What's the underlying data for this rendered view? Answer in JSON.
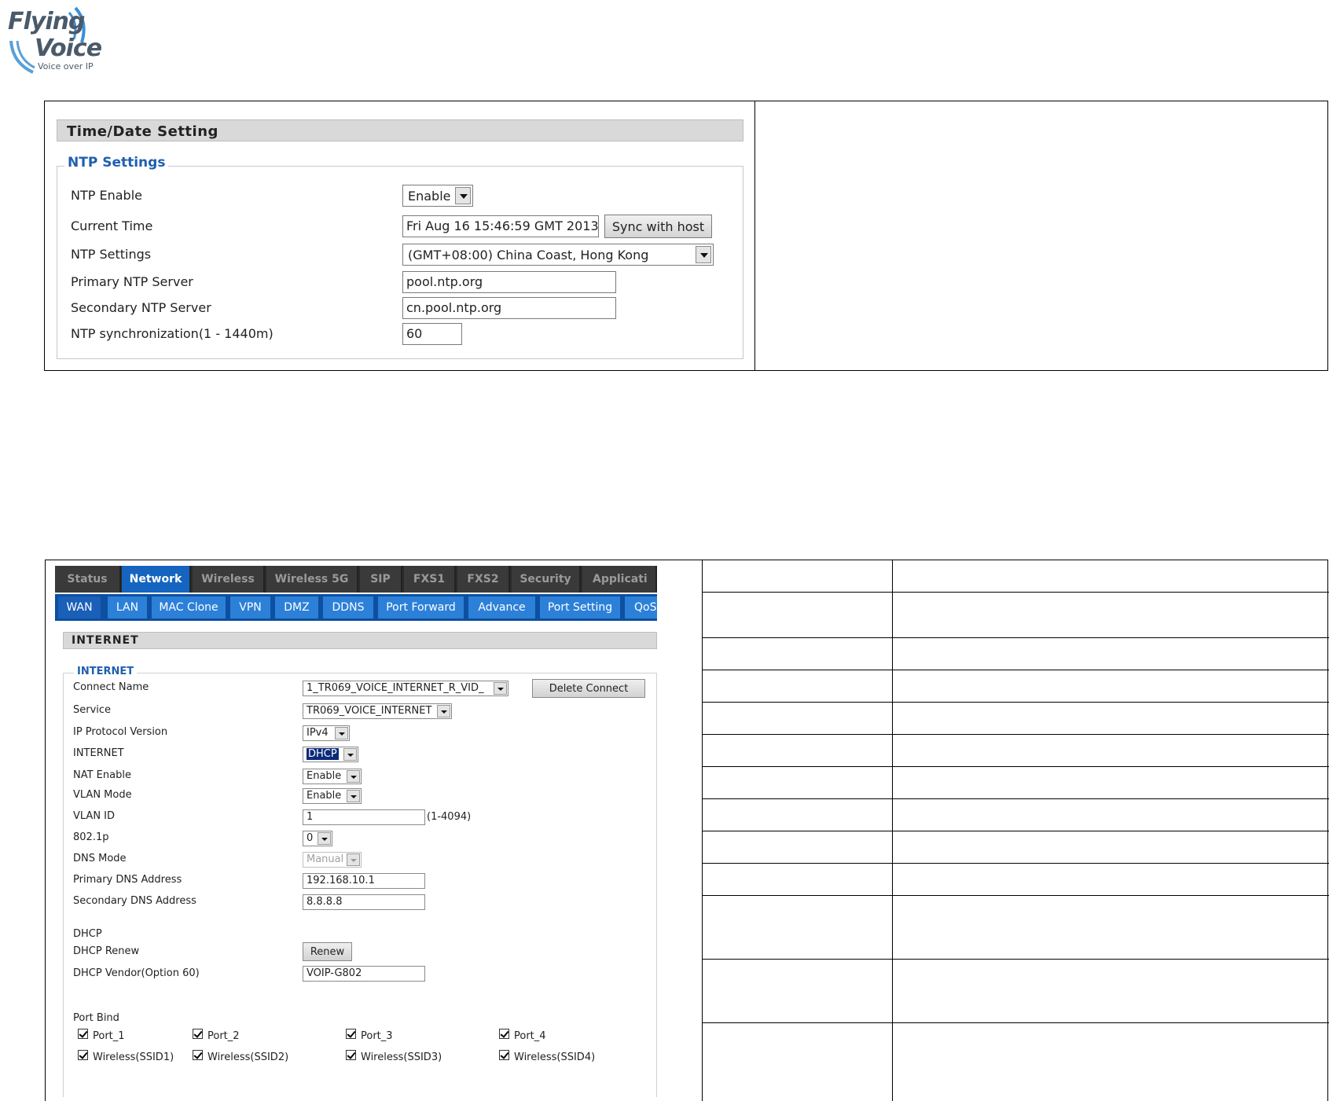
{
  "logo": {
    "line1": "Flying",
    "line2": "Voice",
    "tagline": "Voice over IP"
  },
  "time": {
    "title": "Time/Date Setting",
    "legend": "NTP Settings",
    "labels": {
      "ntp_enable": "NTP Enable",
      "current_time": "Current Time",
      "ntp_settings": "NTP Settings",
      "primary": "Primary NTP Server",
      "secondary": "Secondary NTP Server",
      "sync": "NTP synchronization(1 - 1440m)"
    },
    "values": {
      "ntp_enable": "Enable",
      "current_time": "Fri Aug 16 15:46:59 GMT 2013",
      "timezone": "(GMT+08:00) China Coast, Hong Kong",
      "primary": "pool.ntp.org",
      "secondary": "cn.pool.ntp.org",
      "sync": "60"
    },
    "sync_button": "Sync with host"
  },
  "wan": {
    "tabs": [
      "Status",
      "Network",
      "Wireless",
      "Wireless 5G",
      "SIP",
      "FXS1",
      "FXS2",
      "Security",
      "Applicati"
    ],
    "subtabs": [
      "WAN",
      "LAN",
      "MAC Clone",
      "VPN",
      "DMZ",
      "DDNS",
      "Port Forward",
      "Advance",
      "Port Setting",
      "QoS"
    ],
    "section_title": "INTERNET",
    "legend": "INTERNET",
    "labels": {
      "connect_name": "Connect Name",
      "service": "Service",
      "ip_version": "IP Protocol Version",
      "internet": "INTERNET",
      "nat_enable": "NAT Enable",
      "vlan_mode": "VLAN Mode",
      "vlan_id": "VLAN ID",
      "p8021": "802.1p",
      "dns_mode": "DNS Mode",
      "primary_dns": "Primary DNS Address",
      "secondary_dns": "Secondary DNS Address",
      "dhcp": "DHCP",
      "dhcp_renew": "DHCP Renew",
      "dhcp_vendor": "DHCP Vendor(Option 60)",
      "port_bind": "Port Bind"
    },
    "values": {
      "connect_name": "1_TR069_VOICE_INTERNET_R_VID_",
      "service": "TR069_VOICE_INTERNET",
      "ip_version": "IPv4",
      "internet": "DHCP",
      "nat_enable": "Enable",
      "vlan_mode": "Enable",
      "vlan_id": "1",
      "vlan_range": "(1-4094)",
      "p8021": "0",
      "dns_mode": "Manual",
      "primary_dns": "192.168.10.1",
      "secondary_dns": "8.8.8.8",
      "dhcp_vendor": "VOIP-G802"
    },
    "delete_button": "Delete Connect",
    "renew_button": "Renew",
    "ports": [
      "Port_1",
      "Port_2",
      "Port_3",
      "Port_4"
    ],
    "wireless": [
      "Wireless(SSID1)",
      "Wireless(SSID2)",
      "Wireless(SSID3)",
      "Wireless(SSID4)"
    ]
  }
}
